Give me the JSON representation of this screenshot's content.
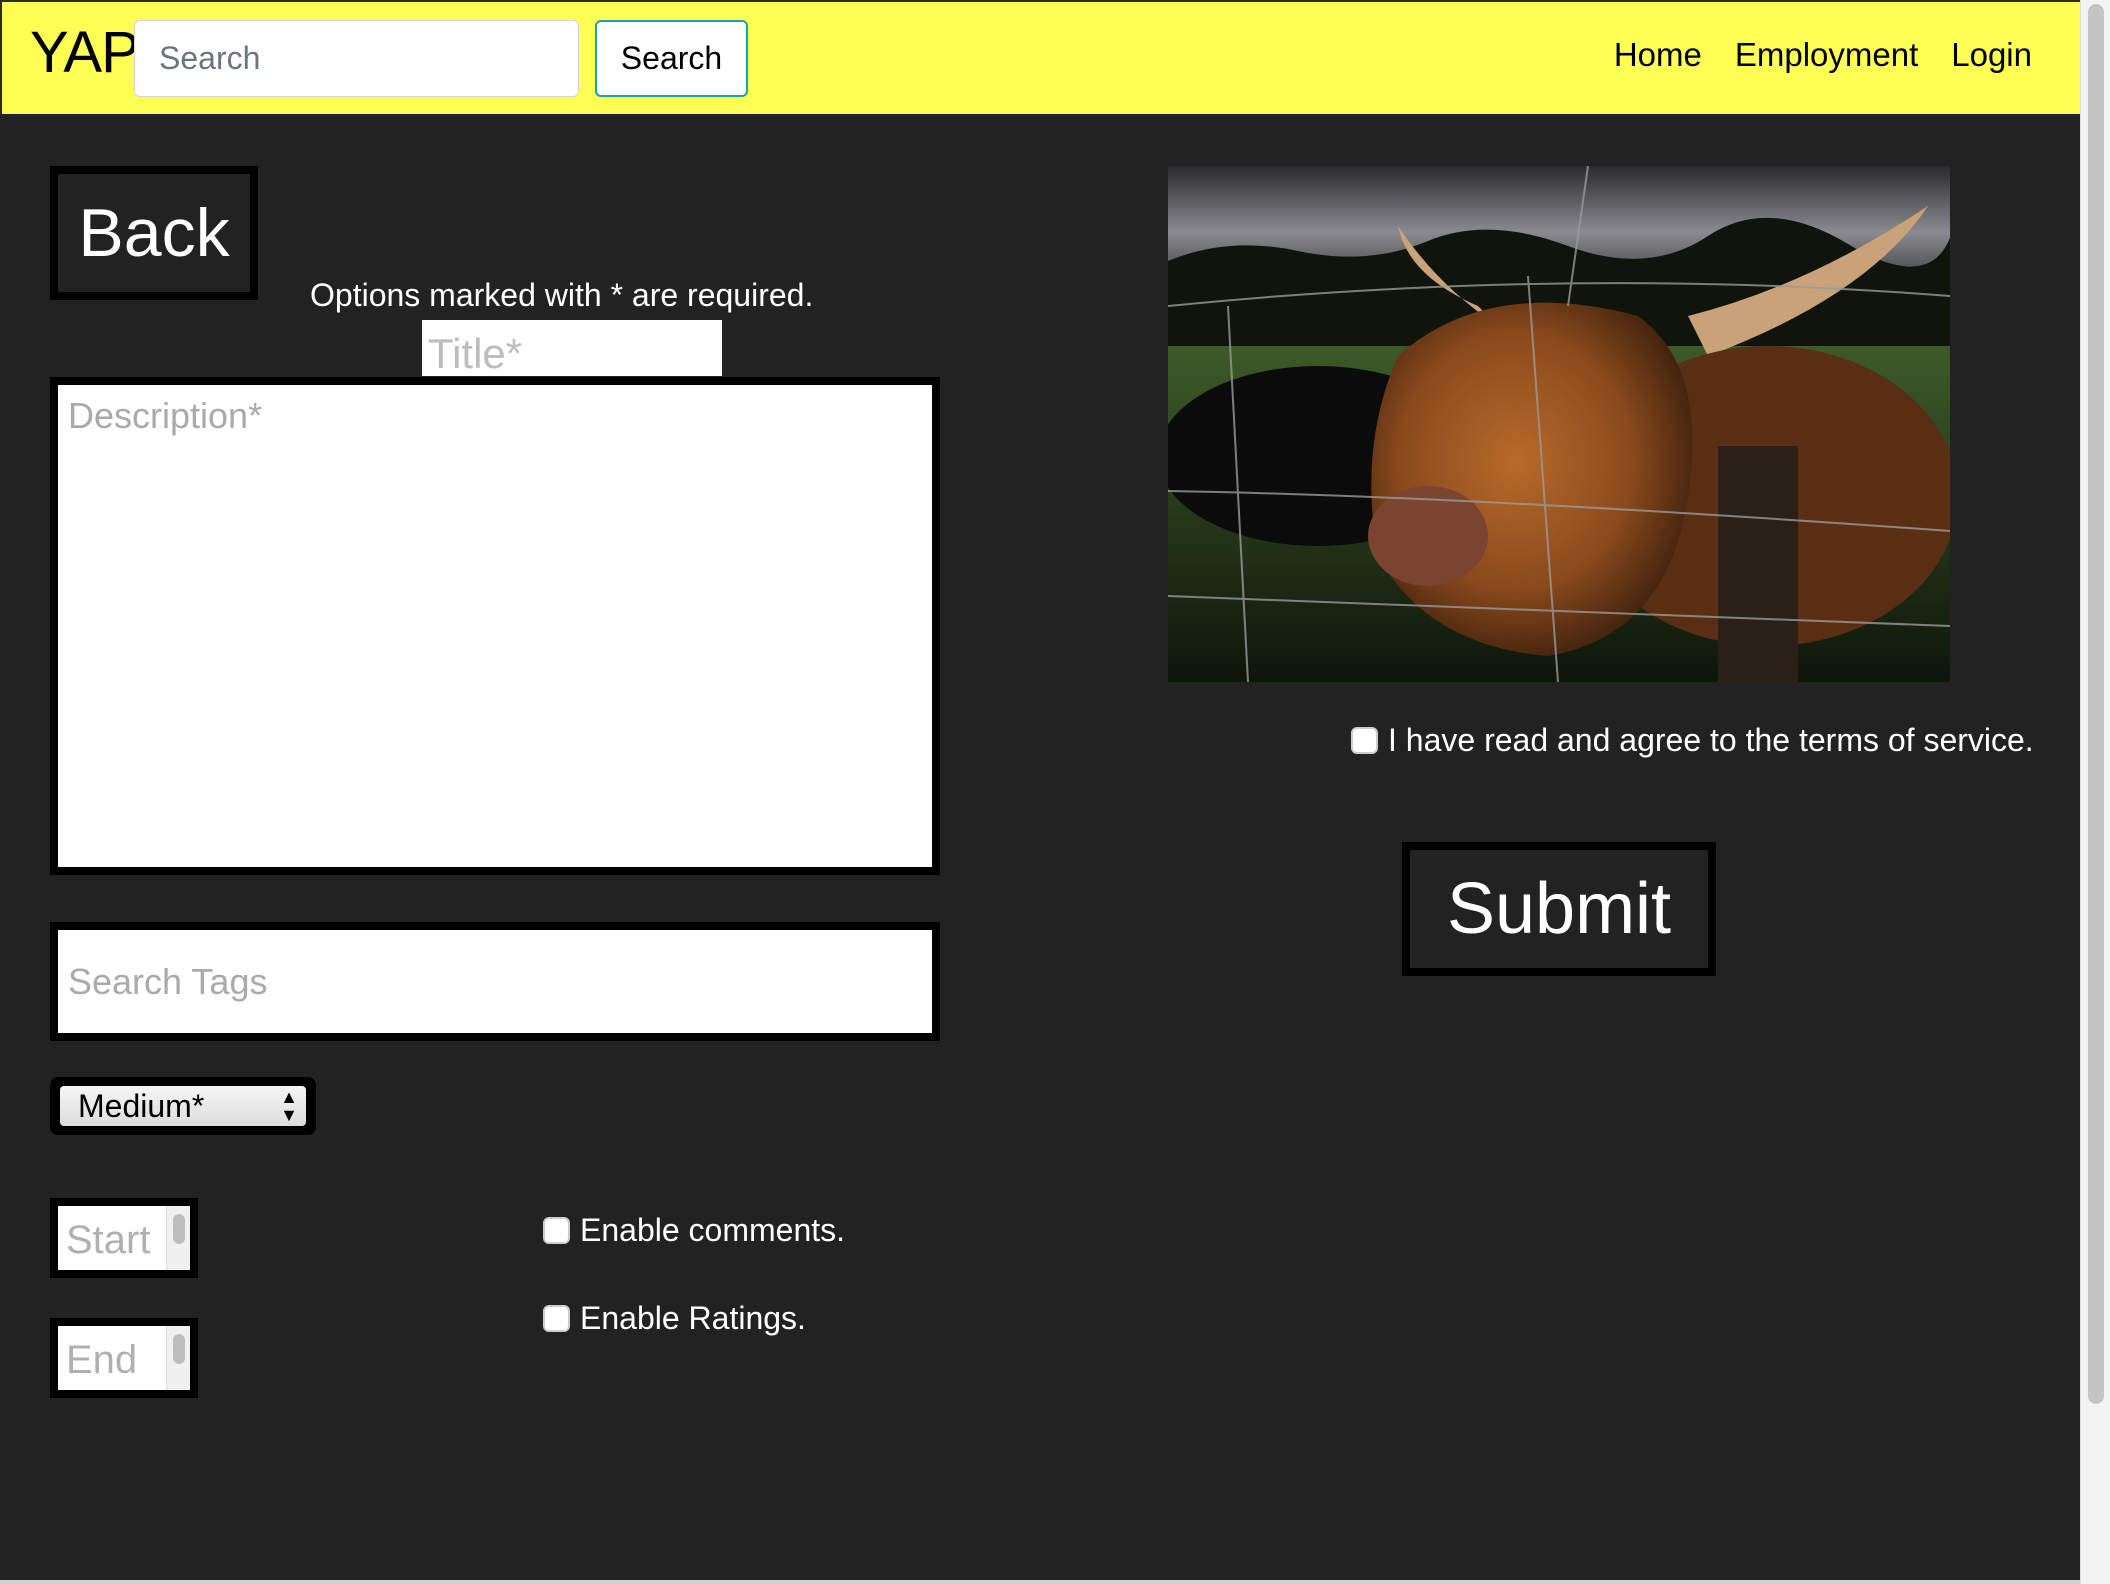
{
  "navbar": {
    "brand": "YAP",
    "search_placeholder": "Search",
    "search_button": "Search",
    "links": [
      "Home",
      "Employment",
      "Login"
    ]
  },
  "form": {
    "back_label": "Back",
    "required_note": "Options marked with * are required.",
    "title_placeholder": "Title*",
    "description_placeholder": "Description*",
    "tags_placeholder": "Search Tags",
    "medium_selected": "Medium*",
    "start_placeholder": "Start",
    "end_placeholder": "End",
    "enable_comments": "Enable comments.",
    "enable_ratings": "Enable Ratings.",
    "terms_label": "I have read and agree to the terms of service.",
    "submit_label": "Submit"
  },
  "image": {
    "subject": "highland-cow-behind-fence"
  }
}
